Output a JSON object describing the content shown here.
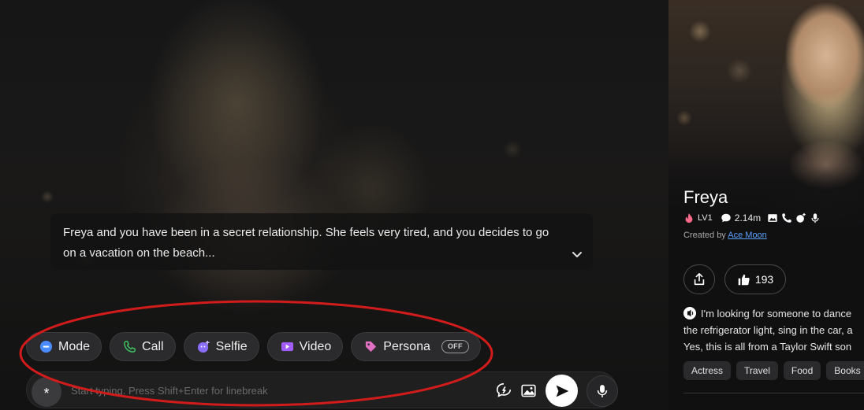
{
  "scenario": {
    "text": "Freya and you have been in a secret relationship. She feels very tired, and you decides to go on a vacation on the beach..."
  },
  "actions": [
    {
      "label": "Mode",
      "icon": "mode-icon"
    },
    {
      "label": "Call",
      "icon": "phone-icon"
    },
    {
      "label": "Selfie",
      "icon": "selfie-icon"
    },
    {
      "label": "Video",
      "icon": "video-icon"
    },
    {
      "label": "Persona",
      "icon": "tag-icon",
      "toggle": "OFF"
    }
  ],
  "input": {
    "magic_label": "*",
    "placeholder": "Start typing. Press Shift+Enter for linebreak"
  },
  "character": {
    "name": "Freya",
    "level": "LV1",
    "chats": "2.14m",
    "created_by_prefix": "Created by",
    "creator": "Ace Moon",
    "likes": "193",
    "bio_line1": "I'm looking for someone to dance",
    "bio_line2": "the refrigerator light, sing in the car, a",
    "bio_line3": "Yes, this is all from a Taylor Swift son",
    "tags": [
      "Actress",
      "Travel",
      "Food",
      "Books"
    ]
  },
  "colors": {
    "accent_mode": "#4a8cff",
    "accent_call": "#3cc060",
    "accent_selfie": "#8a6cff",
    "accent_video": "#a05cff",
    "accent_persona": "#e070c0",
    "highlight_ellipse": "#d21c1c",
    "link": "#5aa0ff"
  }
}
